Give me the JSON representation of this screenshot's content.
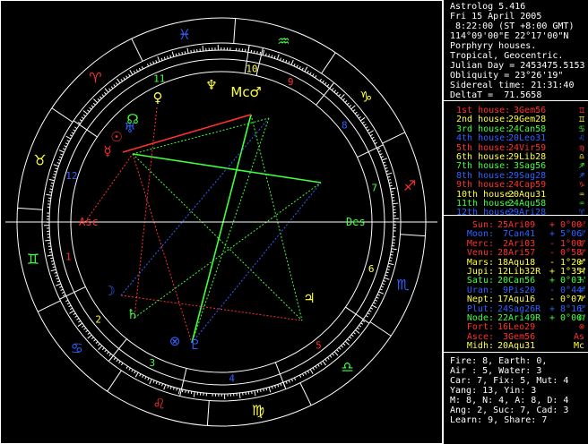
{
  "header": {
    "lines": [
      "Astrolog 5.416",
      "Fri 15 April 2005",
      " 8:22:00 (ST +8:00 GMT)",
      "114°09'00\"E 22°17'00\"N",
      "Porphyry houses.",
      "Tropical, Geocentric.",
      "Julian Day = 2453475.5153",
      "Obliquity = 23°26'19\"",
      "Sidereal time: 21:31:40",
      "DeltaT =  71.5658"
    ]
  },
  "houses": [
    {
      "name": "1st house:",
      "pos": " 3Gem56",
      "color": "#ff3030",
      "glyph": "♊"
    },
    {
      "name": "2nd house:",
      "pos": "29Gem28",
      "color": "#ffff40",
      "glyph": "♊"
    },
    {
      "name": "3rd house:",
      "pos": "24Can58",
      "color": "#40ff40",
      "glyph": "♋"
    },
    {
      "name": "4th house:",
      "pos": "20Leo31",
      "color": "#3060ff",
      "glyph": "♌"
    },
    {
      "name": "5th house:",
      "pos": "24Vir59",
      "color": "#ff3030",
      "glyph": "♍"
    },
    {
      "name": "6th house:",
      "pos": "29Lib28",
      "color": "#ffff40",
      "glyph": "♎"
    },
    {
      "name": "7th house:",
      "pos": " 3Sag56",
      "color": "#40ff40",
      "glyph": "♐"
    },
    {
      "name": "8th house:",
      "pos": "29Sag28",
      "color": "#3060ff",
      "glyph": "♐"
    },
    {
      "name": "9th house:",
      "pos": "24Cap59",
      "color": "#ff3030",
      "glyph": "♑"
    },
    {
      "name": "10th house:",
      "pos": "20Aqu31",
      "color": "#ffff40",
      "glyph": "♒"
    },
    {
      "name": "11th house:",
      "pos": "24Aqu58",
      "color": "#40ff40",
      "glyph": "♒"
    },
    {
      "name": "12th house:",
      "pos": "29Ari28",
      "color": "#3060ff",
      "glyph": "♈"
    }
  ],
  "planets": [
    {
      "name": "Sun:",
      "pos": "25Ari09",
      "vel": "+ 0°00'",
      "color": "#ff3030",
      "glyph": "☉"
    },
    {
      "name": "Moon:",
      "pos": " 7Can41",
      "vel": "+ 5°06'",
      "color": "#3060ff",
      "glyph": "☽"
    },
    {
      "name": "Merc:",
      "pos": " 2Ari03",
      "vel": "- 1°00'",
      "color": "#ff3030",
      "glyph": "☿"
    },
    {
      "name": "Venu:",
      "pos": "28Ari57",
      "vel": "- 0°58'",
      "color": "#ff3030",
      "glyph": "♀"
    },
    {
      "name": "Mars:",
      "pos": "18Aqu18",
      "vel": "- 1°20'",
      "color": "#ffff40",
      "glyph": "♂"
    },
    {
      "name": "Jupi:",
      "pos": "12Lib32R",
      "vel": "+ 1°35'",
      "color": "#ffff40",
      "glyph": "♃"
    },
    {
      "name": "Satu:",
      "pos": "20Can56",
      "vel": "+ 0°03'",
      "color": "#40ff40",
      "glyph": "♄"
    },
    {
      "name": "Uran:",
      "pos": " 9Pis20",
      "vel": "- 0°44'",
      "color": "#3060ff",
      "glyph": "♅"
    },
    {
      "name": "Nept:",
      "pos": "17Aqu16",
      "vel": "- 0°07'",
      "color": "#ffff40",
      "glyph": "♆"
    },
    {
      "name": "Plut:",
      "pos": "24Sag26R",
      "vel": "+ 8°16'",
      "color": "#3060ff",
      "glyph": "♇"
    },
    {
      "name": "Node:",
      "pos": "22Ari49R",
      "vel": "+ 0°00'",
      "color": "#40ff40",
      "glyph": "☊"
    },
    {
      "name": "Fort:",
      "pos": "16Leo29",
      "vel": "",
      "color": "#ff3030",
      "glyph": "⊗"
    },
    {
      "name": "Asce:",
      "pos": " 3Gem56",
      "vel": "",
      "color": "#ff3030",
      "glyph": "As"
    },
    {
      "name": "Midh:",
      "pos": "20Aqu31",
      "vel": "",
      "color": "#ffff40",
      "glyph": "Mc"
    }
  ],
  "stats": [
    "Fire: 8, Earth: 0,",
    "Air : 5, Water: 3",
    "Car: 7, Fix: 5, Mut: 4",
    "Yang: 13, Yin: 3",
    "M: 8, N: 4, A: 8, D: 4",
    "Ang: 2, Suc: 7, Cad: 3",
    "Learn: 9, Share: 7"
  ],
  "wheel": {
    "axis_labels": {
      "asc": "Asc",
      "des": "Des"
    },
    "house_numbers": [
      "1",
      "2",
      "3",
      "4",
      "5",
      "6",
      "7",
      "8",
      "9",
      "10",
      "11",
      "12"
    ],
    "sign_glyphs": [
      "♉",
      "♊",
      "♋",
      "♌",
      "♍",
      "♎",
      "♏",
      "♐",
      "♑",
      "♒",
      "♓",
      "♈"
    ],
    "colors": {
      "red": "#ff3030",
      "yellow": "#ffff40",
      "green": "#40ff40",
      "blue": "#3060ff",
      "white": "#ffffff"
    }
  }
}
